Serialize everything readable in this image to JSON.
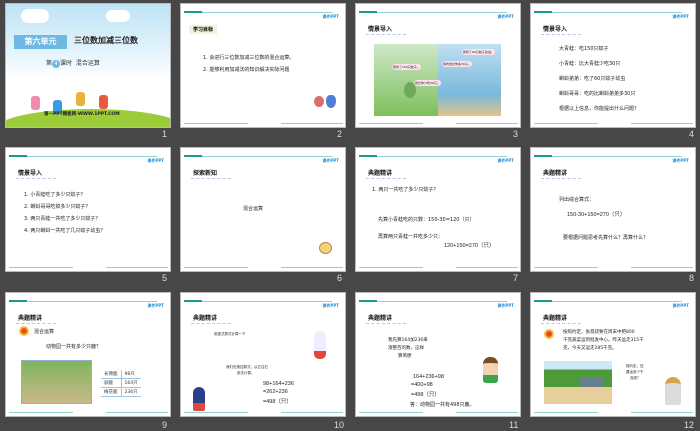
{
  "slides": [
    {
      "number": "1",
      "unit": "第六单元",
      "title": "三位数加减三位数",
      "lesson_prefix": "第",
      "lesson_num": "4",
      "lesson_suffix": "课时",
      "lesson_title": "混合运算",
      "watermark": "第一PPT模板网-WWW.1PPT.COM"
    },
    {
      "number": "2",
      "heading": "学习目标",
      "items": [
        "1. 会进行三位数加减三位数的混合运算。",
        "2. 能够利用加减法的知识解决实际问题"
      ]
    },
    {
      "number": "3",
      "heading": "情景导入",
      "bubbles": [
        "我吃了150只蚊子。",
        "我比你少吃30只。",
        "我吃了60只蚊子幼虫。",
        "我吃的比你多30只。"
      ]
    },
    {
      "number": "4",
      "heading": "情景导入",
      "items": [
        "大青蛙：吃150只蚊子",
        "小青蛙：比大青蛙少吃30只",
        "蝌蚪弟弟：吃了60只蚊子幼虫",
        "蝌蚪哥哥：吃的比蝌蚪弟弟多30只",
        "根据以上信息，你能提出什么问题？"
      ]
    },
    {
      "number": "5",
      "heading": "情景导入",
      "items": [
        "1. 小青蛙吃了多少只蚊子？",
        "2. 蝌蚪哥哥吃掉多少只蚊子？",
        "3. 两只青蛙一共吃了多少只蚊子？",
        "4. 两只蝌蚪一共吃了几只蚊子幼虫？"
      ]
    },
    {
      "number": "6",
      "heading": "探索新知",
      "body": "混合运算"
    },
    {
      "number": "7",
      "heading": "典题精讲",
      "question": "1. 两只一共吃了多少只蚊子？",
      "step1": "先算小青蛙吃的只数：150-30=120（只）",
      "step2": "再算两只青蛙一共吃多少只：",
      "step2_eq": "120+150=270（只）"
    },
    {
      "number": "8",
      "heading": "典题精讲",
      "line1": "列出综合算式：",
      "eq": "150-30+150=270（只）",
      "line2": "要根据问题思考先算什么？再算什么？"
    },
    {
      "number": "9",
      "heading": "典题精讲",
      "label": "混合运算",
      "question": "动物园一共有多少只鹿？",
      "table": [
        [
          "长颈鹿",
          "98只"
        ],
        [
          "驯鹿",
          "164只"
        ],
        [
          "梅花鹿",
          "236只"
        ]
      ]
    },
    {
      "number": "10",
      "heading": "典题精讲",
      "caption": "用竖式算式计算一下",
      "note1": "我们也按加算式，从左往右",
      "note2": "依次计算。",
      "eq": [
        "98+164+236",
        "=262+236",
        "=498（只）"
      ]
    },
    {
      "number": "11",
      "heading": "典题精讲",
      "note": [
        "我先算164加236来",
        "凑整百的数，这样",
        "算简便"
      ],
      "eq": [
        "164+236+98",
        "=400+98",
        "=498（只）"
      ],
      "answer": "答：动物园一共有498只鹿。"
    },
    {
      "number": "12",
      "heading": "典题精讲",
      "problem": [
        "按照约定，张叔叔要在周末中把800",
        "千克蔬菜运到批发中心。昨天运走315千",
        "克，今天又运走285千克。"
      ],
      "bubble": [
        "按约定，还",
        "要运多少千",
        "克呢？"
      ]
    }
  ],
  "logo_text": "课件PPT"
}
